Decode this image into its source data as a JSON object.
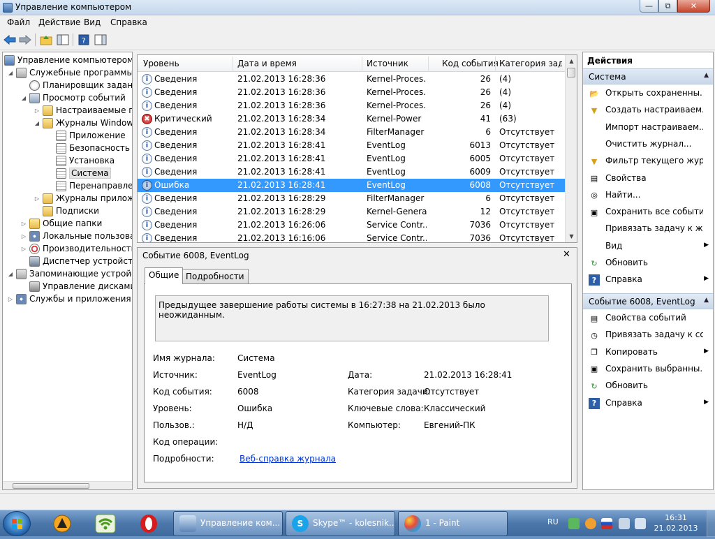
{
  "window": {
    "title": "Управление компьютером"
  },
  "menu": [
    "Файл",
    "Действие",
    "Вид",
    "Справка"
  ],
  "toolbar": {
    "icons": [
      "back-arrow-icon",
      "forward-arrow-icon",
      "up-folder-icon",
      "show-hide-console-tree-icon",
      "help-icon",
      "properties-pane-icon"
    ]
  },
  "tree": [
    {
      "label": "Управление компьютером (л",
      "icon": "computer-icon"
    },
    {
      "label": "Служебные программы",
      "icon": "tools-icon"
    },
    {
      "label": "Планировщик заданий",
      "icon": "clock-icon"
    },
    {
      "label": "Просмотр событий",
      "icon": "event-viewer-icon"
    },
    {
      "label": "Настраиваемые пр",
      "icon": "folder-icon"
    },
    {
      "label": "Журналы Windows",
      "icon": "folder-icon"
    },
    {
      "label": "Приложение",
      "icon": "log-icon"
    },
    {
      "label": "Безопасность",
      "icon": "log-icon"
    },
    {
      "label": "Установка",
      "icon": "log-icon"
    },
    {
      "label": "Система",
      "icon": "log-icon"
    },
    {
      "label": "Перенаправлен",
      "icon": "log-icon"
    },
    {
      "label": "Журналы приложе",
      "icon": "folder-icon"
    },
    {
      "label": "Подписки",
      "icon": "folder-icon"
    },
    {
      "label": "Общие папки",
      "icon": "shared-folder-icon"
    },
    {
      "label": "Локальные пользовате",
      "icon": "users-icon"
    },
    {
      "label": "Производительность",
      "icon": "performance-icon"
    },
    {
      "label": "Диспетчер устройств",
      "icon": "device-manager-icon"
    },
    {
      "label": "Запоминающие устройст",
      "icon": "storage-icon"
    },
    {
      "label": "Управление дисками",
      "icon": "disk-icon"
    },
    {
      "label": "Службы и приложения",
      "icon": "services-icon"
    }
  ],
  "events": {
    "columns": [
      "Уровень",
      "Дата и время",
      "Источник",
      "Код события",
      "Категория зада..."
    ],
    "rows": [
      {
        "level": "Сведения",
        "kind": "info",
        "datetime": "21.02.2013 16:28:36",
        "source": "Kernel-Proces...",
        "id": "26",
        "category": "(4)"
      },
      {
        "level": "Сведения",
        "kind": "info",
        "datetime": "21.02.2013 16:28:36",
        "source": "Kernel-Proces...",
        "id": "26",
        "category": "(4)"
      },
      {
        "level": "Сведения",
        "kind": "info",
        "datetime": "21.02.2013 16:28:36",
        "source": "Kernel-Proces...",
        "id": "26",
        "category": "(4)"
      },
      {
        "level": "Критический",
        "kind": "crit",
        "datetime": "21.02.2013 16:28:34",
        "source": "Kernel-Power",
        "id": "41",
        "category": "(63)"
      },
      {
        "level": "Сведения",
        "kind": "info",
        "datetime": "21.02.2013 16:28:34",
        "source": "FilterManager",
        "id": "6",
        "category": "Отсутствует"
      },
      {
        "level": "Сведения",
        "kind": "info",
        "datetime": "21.02.2013 16:28:41",
        "source": "EventLog",
        "id": "6013",
        "category": "Отсутствует"
      },
      {
        "level": "Сведения",
        "kind": "info",
        "datetime": "21.02.2013 16:28:41",
        "source": "EventLog",
        "id": "6005",
        "category": "Отсутствует"
      },
      {
        "level": "Сведения",
        "kind": "info",
        "datetime": "21.02.2013 16:28:41",
        "source": "EventLog",
        "id": "6009",
        "category": "Отсутствует"
      },
      {
        "level": "Ошибка",
        "kind": "err",
        "datetime": "21.02.2013 16:28:41",
        "source": "EventLog",
        "id": "6008",
        "category": "Отсутствует",
        "selected": true
      },
      {
        "level": "Сведения",
        "kind": "info",
        "datetime": "21.02.2013 16:28:29",
        "source": "FilterManager",
        "id": "6",
        "category": "Отсутствует"
      },
      {
        "level": "Сведения",
        "kind": "info",
        "datetime": "21.02.2013 16:28:29",
        "source": "Kernel-General",
        "id": "12",
        "category": "Отсутствует"
      },
      {
        "level": "Сведения",
        "kind": "info",
        "datetime": "21.02.2013 16:26:06",
        "source": "Service Contr...",
        "id": "7036",
        "category": "Отсутствует"
      },
      {
        "level": "Сведения",
        "kind": "info",
        "datetime": "21.02.2013 16:16:06",
        "source": "Service Contr...",
        "id": "7036",
        "category": "Отсутствует"
      }
    ]
  },
  "detail": {
    "title": "Событие 6008, EventLog",
    "tabs": [
      "Общие",
      "Подробности"
    ],
    "message": "Предыдущее завершение работы системы в 16:27:38 на 21.02.2013 было неожиданным.",
    "fields": {
      "log_name_label": "Имя журнала:",
      "log_name": "Система",
      "source_label": "Источник:",
      "source": "EventLog",
      "date_label": "Дата:",
      "date": "21.02.2013 16:28:41",
      "event_id_label": "Код события:",
      "event_id": "6008",
      "task_category_label": "Категория задачи:",
      "task_category": "Отсутствует",
      "level_label": "Уровень:",
      "level": "Ошибка",
      "keywords_label": "Ключевые слова:",
      "keywords": "Классический",
      "user_label": "Пользов.:",
      "user": "Н/Д",
      "computer_label": "Компьютер:",
      "computer": "Евгений-ПК",
      "opcode_label": "Код операции:",
      "more_info_label": "Подробности:",
      "more_info_link": "Веб-справка журнала"
    }
  },
  "actions": {
    "title": "Действия",
    "section1": "Система",
    "items1": [
      {
        "label": "Открыть сохраненны...",
        "icon": "open-folder-icon"
      },
      {
        "label": "Создать настраиваем...",
        "icon": "filter-icon"
      },
      {
        "label": "Импорт настраиваем...",
        "icon": ""
      },
      {
        "label": "Очистить журнал...",
        "icon": ""
      },
      {
        "label": "Фильтр текущего жур...",
        "icon": "filter-icon"
      },
      {
        "label": "Свойства",
        "icon": "properties-icon"
      },
      {
        "label": "Найти...",
        "icon": "find-binoculars-icon"
      },
      {
        "label": "Сохранить все событи...",
        "icon": "save-icon"
      },
      {
        "label": "Привязать задачу к жу...",
        "icon": ""
      },
      {
        "label": "Вид",
        "icon": "",
        "submenu": true
      },
      {
        "label": "Обновить",
        "icon": "refresh-icon"
      },
      {
        "label": "Справка",
        "icon": "help-icon",
        "submenu": true
      }
    ],
    "section2": "Событие 6008, EventLog",
    "items2": [
      {
        "label": "Свойства событий",
        "icon": "properties-icon"
      },
      {
        "label": "Привязать задачу к со...",
        "icon": "task-clock-icon"
      },
      {
        "label": "Копировать",
        "icon": "copy-icon",
        "submenu": true
      },
      {
        "label": "Сохранить выбранны...",
        "icon": "save-icon"
      },
      {
        "label": "Обновить",
        "icon": "refresh-icon"
      },
      {
        "label": "Справка",
        "icon": "help-icon",
        "submenu": true
      }
    ]
  },
  "taskbar": {
    "buttons": [
      {
        "label": "Управление ком...",
        "icon": "computer-management-icon"
      },
      {
        "label": "Skype™ - kolesnik...",
        "icon": "skype-icon"
      },
      {
        "label": "1 - Paint",
        "icon": "paint-icon"
      }
    ],
    "lang": "RU",
    "time": "16:31",
    "date": "21.02.2013"
  },
  "colors": {
    "selection": "#3399ff",
    "link": "#0033cc",
    "critical": "#c41919"
  }
}
